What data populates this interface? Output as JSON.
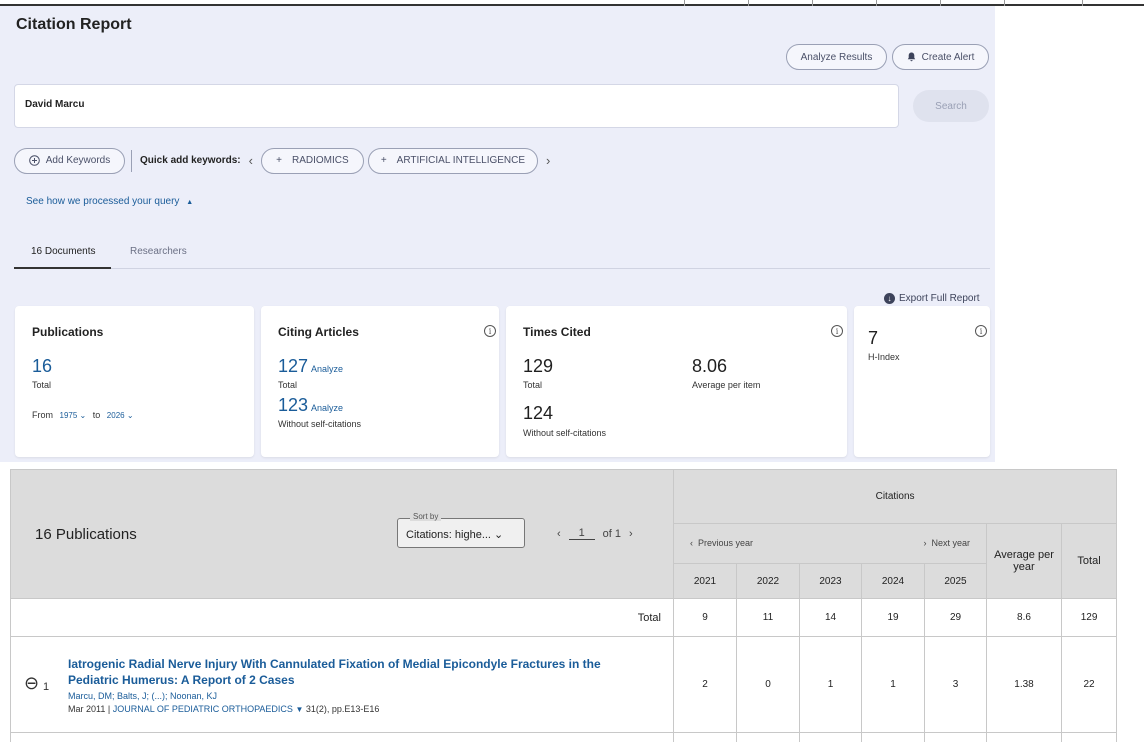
{
  "header": {
    "title": "Citation Report"
  },
  "actions": {
    "analyze_label": "Analyze Results",
    "alert_label": "Create Alert"
  },
  "search": {
    "query": "David Marcu",
    "button_label": "Search"
  },
  "keywords": {
    "add_label": "Add Keywords",
    "quick_label": "Quick add keywords:",
    "items": [
      "RADIOMICS",
      "ARTIFICIAL INTELLIGENCE"
    ]
  },
  "processed_label": "See how we processed your query",
  "tabs": [
    {
      "label": "16 Documents"
    },
    {
      "label": "Researchers"
    }
  ],
  "export_label": "Export Full Report",
  "cards": {
    "publications": {
      "title": "Publications",
      "value": "16",
      "value_label": "Total",
      "from_label": "From",
      "from_year": "1975",
      "to_label": "to",
      "to_year": "2026"
    },
    "citing": {
      "title": "Citing Articles",
      "total": "127",
      "total_label": "Total",
      "analyze": "Analyze",
      "without": "123",
      "without_label": "Without self-citations"
    },
    "times_cited": {
      "title": "Times Cited",
      "total": "129",
      "total_label": "Total",
      "avg": "8.06",
      "avg_label": "Average per item",
      "without": "124",
      "without_label": "Without self-citations"
    },
    "h_index": {
      "value": "7",
      "label": "H-Index"
    }
  },
  "table": {
    "pub_count_label": "16 Publications",
    "sort_label": "Sort by",
    "sort_value": "Citations: highe...",
    "page": "1",
    "of_label": "of 1",
    "citations_header": "Citations",
    "prev_label": "Previous year",
    "next_label": "Next year",
    "years": [
      "2021",
      "2022",
      "2023",
      "2024",
      "2025"
    ],
    "avg_header": "Average per year",
    "total_header": "Total",
    "totals_label": "Total",
    "totals": [
      "9",
      "11",
      "14",
      "19",
      "29",
      "8.6",
      "129"
    ],
    "rows": [
      {
        "index": "1",
        "title": "Iatrogenic Radial Nerve Injury With Cannulated Fixation of Medial Epicondyle Fractures in the Pediatric Humerus: A Report of 2 Cases",
        "authors": "Marcu, DM; Balts, J; (...); Noonan, KJ",
        "date": "Mar 2011 |",
        "journal": "JOURNAL OF PEDIATRIC ORTHOPAEDICS",
        "pages": "31(2), pp.E13-E16",
        "values": [
          "2",
          "0",
          "1",
          "1",
          "3",
          "1.38",
          "22"
        ]
      }
    ]
  }
}
